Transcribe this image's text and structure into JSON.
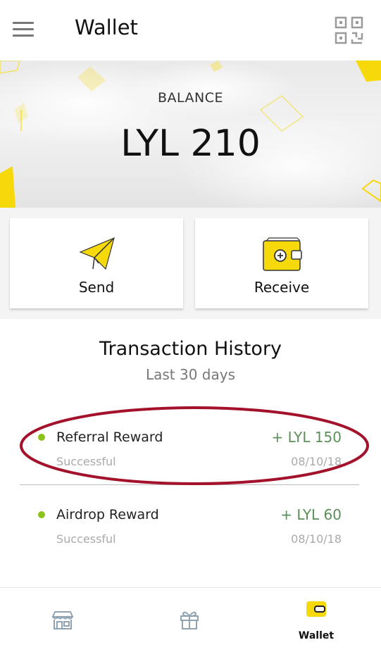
{
  "header": {
    "title": "Wallet",
    "menu_icon": "hamburger-menu-icon",
    "qr_icon": "qr-code-icon"
  },
  "balance": {
    "label": "BALANCE",
    "amount": "LYL 210"
  },
  "actions": {
    "send": {
      "label": "Send",
      "icon": "paper-plane-icon"
    },
    "receive": {
      "label": "Receive",
      "icon": "wallet-plus-icon"
    }
  },
  "history": {
    "title": "Transaction History",
    "subtitle": "Last 30 days",
    "transactions": [
      {
        "name": "Referral Reward",
        "amount": "+ LYL 150",
        "status": "Successful",
        "date": "08/10/18"
      },
      {
        "name": "Airdrop Reward",
        "amount": "+ LYL 60",
        "status": "Successful",
        "date": "08/10/18"
      }
    ]
  },
  "bottom_nav": {
    "items": [
      {
        "icon": "store-icon",
        "label": ""
      },
      {
        "icon": "gift-icon",
        "label": ""
      },
      {
        "icon": "wallet-icon",
        "label": "Wallet"
      }
    ]
  },
  "colors": {
    "accent": "#f5d90a",
    "positive_amount": "#5a8f5a",
    "status_dot": "#8dc11c",
    "highlight_ring": "#a3122a"
  }
}
